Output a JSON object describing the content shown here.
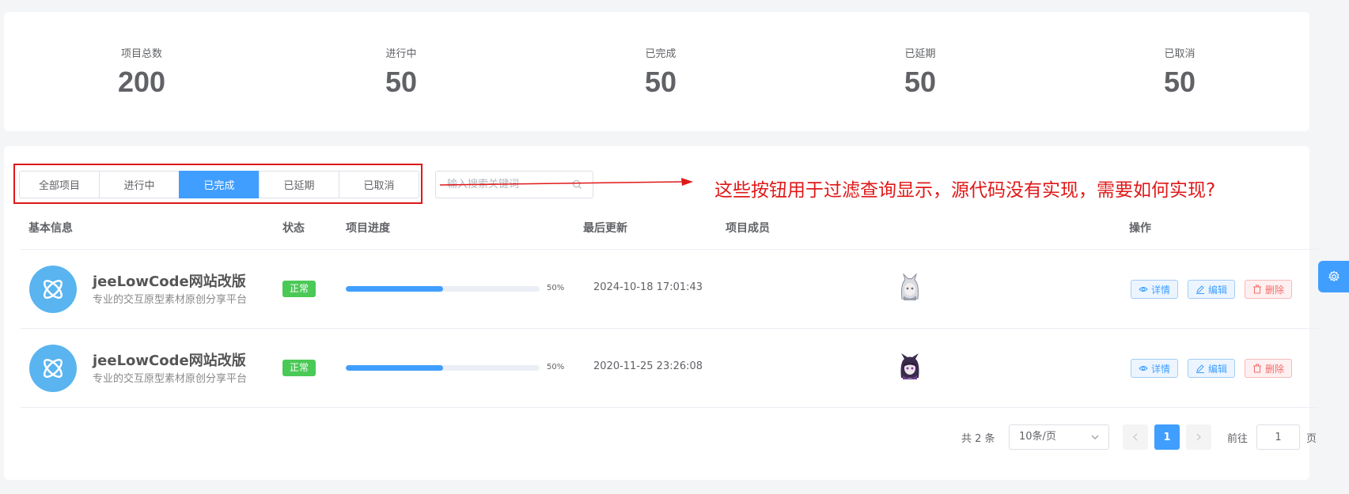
{
  "stats": [
    {
      "label": "项目总数",
      "value": "200"
    },
    {
      "label": "进行中",
      "value": "50"
    },
    {
      "label": "已完成",
      "value": "50"
    },
    {
      "label": "已延期",
      "value": "50"
    },
    {
      "label": "已取消",
      "value": "50"
    }
  ],
  "filters": {
    "items": [
      "全部项目",
      "进行中",
      "已完成",
      "已延期",
      "已取消"
    ],
    "active": "已完成"
  },
  "search": {
    "placeholder": "输入搜索关键词",
    "value": ""
  },
  "annotation": "这些按钮用于过滤查询显示，源代码没有实现，需要如何实现?",
  "table": {
    "headers": [
      "基本信息",
      "状态",
      "项目进度",
      "最后更新",
      "项目成员",
      "操作"
    ],
    "rows": [
      {
        "name": "jeeLowCode网站改版",
        "desc": "专业的交互原型素材原创分享平台",
        "status": "正常",
        "progress_label": "50%",
        "progress": 50,
        "updated": "2024-10-18 17:01:43"
      },
      {
        "name": "jeeLowCode网站改版",
        "desc": "专业的交互原型素材原创分享平台",
        "status": "正常",
        "progress_label": "50%",
        "progress": 50,
        "updated": "2020-11-25 23:26:08"
      }
    ],
    "actions": {
      "detail": "详情",
      "edit": "编辑",
      "delete": "删除"
    }
  },
  "pagination": {
    "total": "共 2 条",
    "page_size": "10条/页",
    "current": "1",
    "goto_prefix": "前往",
    "goto_value": "1",
    "goto_suffix": "页"
  },
  "colors": {
    "primary": "#409eff",
    "success": "#4bc956",
    "danger": "#f56c6c",
    "annotation": "#e01818"
  }
}
